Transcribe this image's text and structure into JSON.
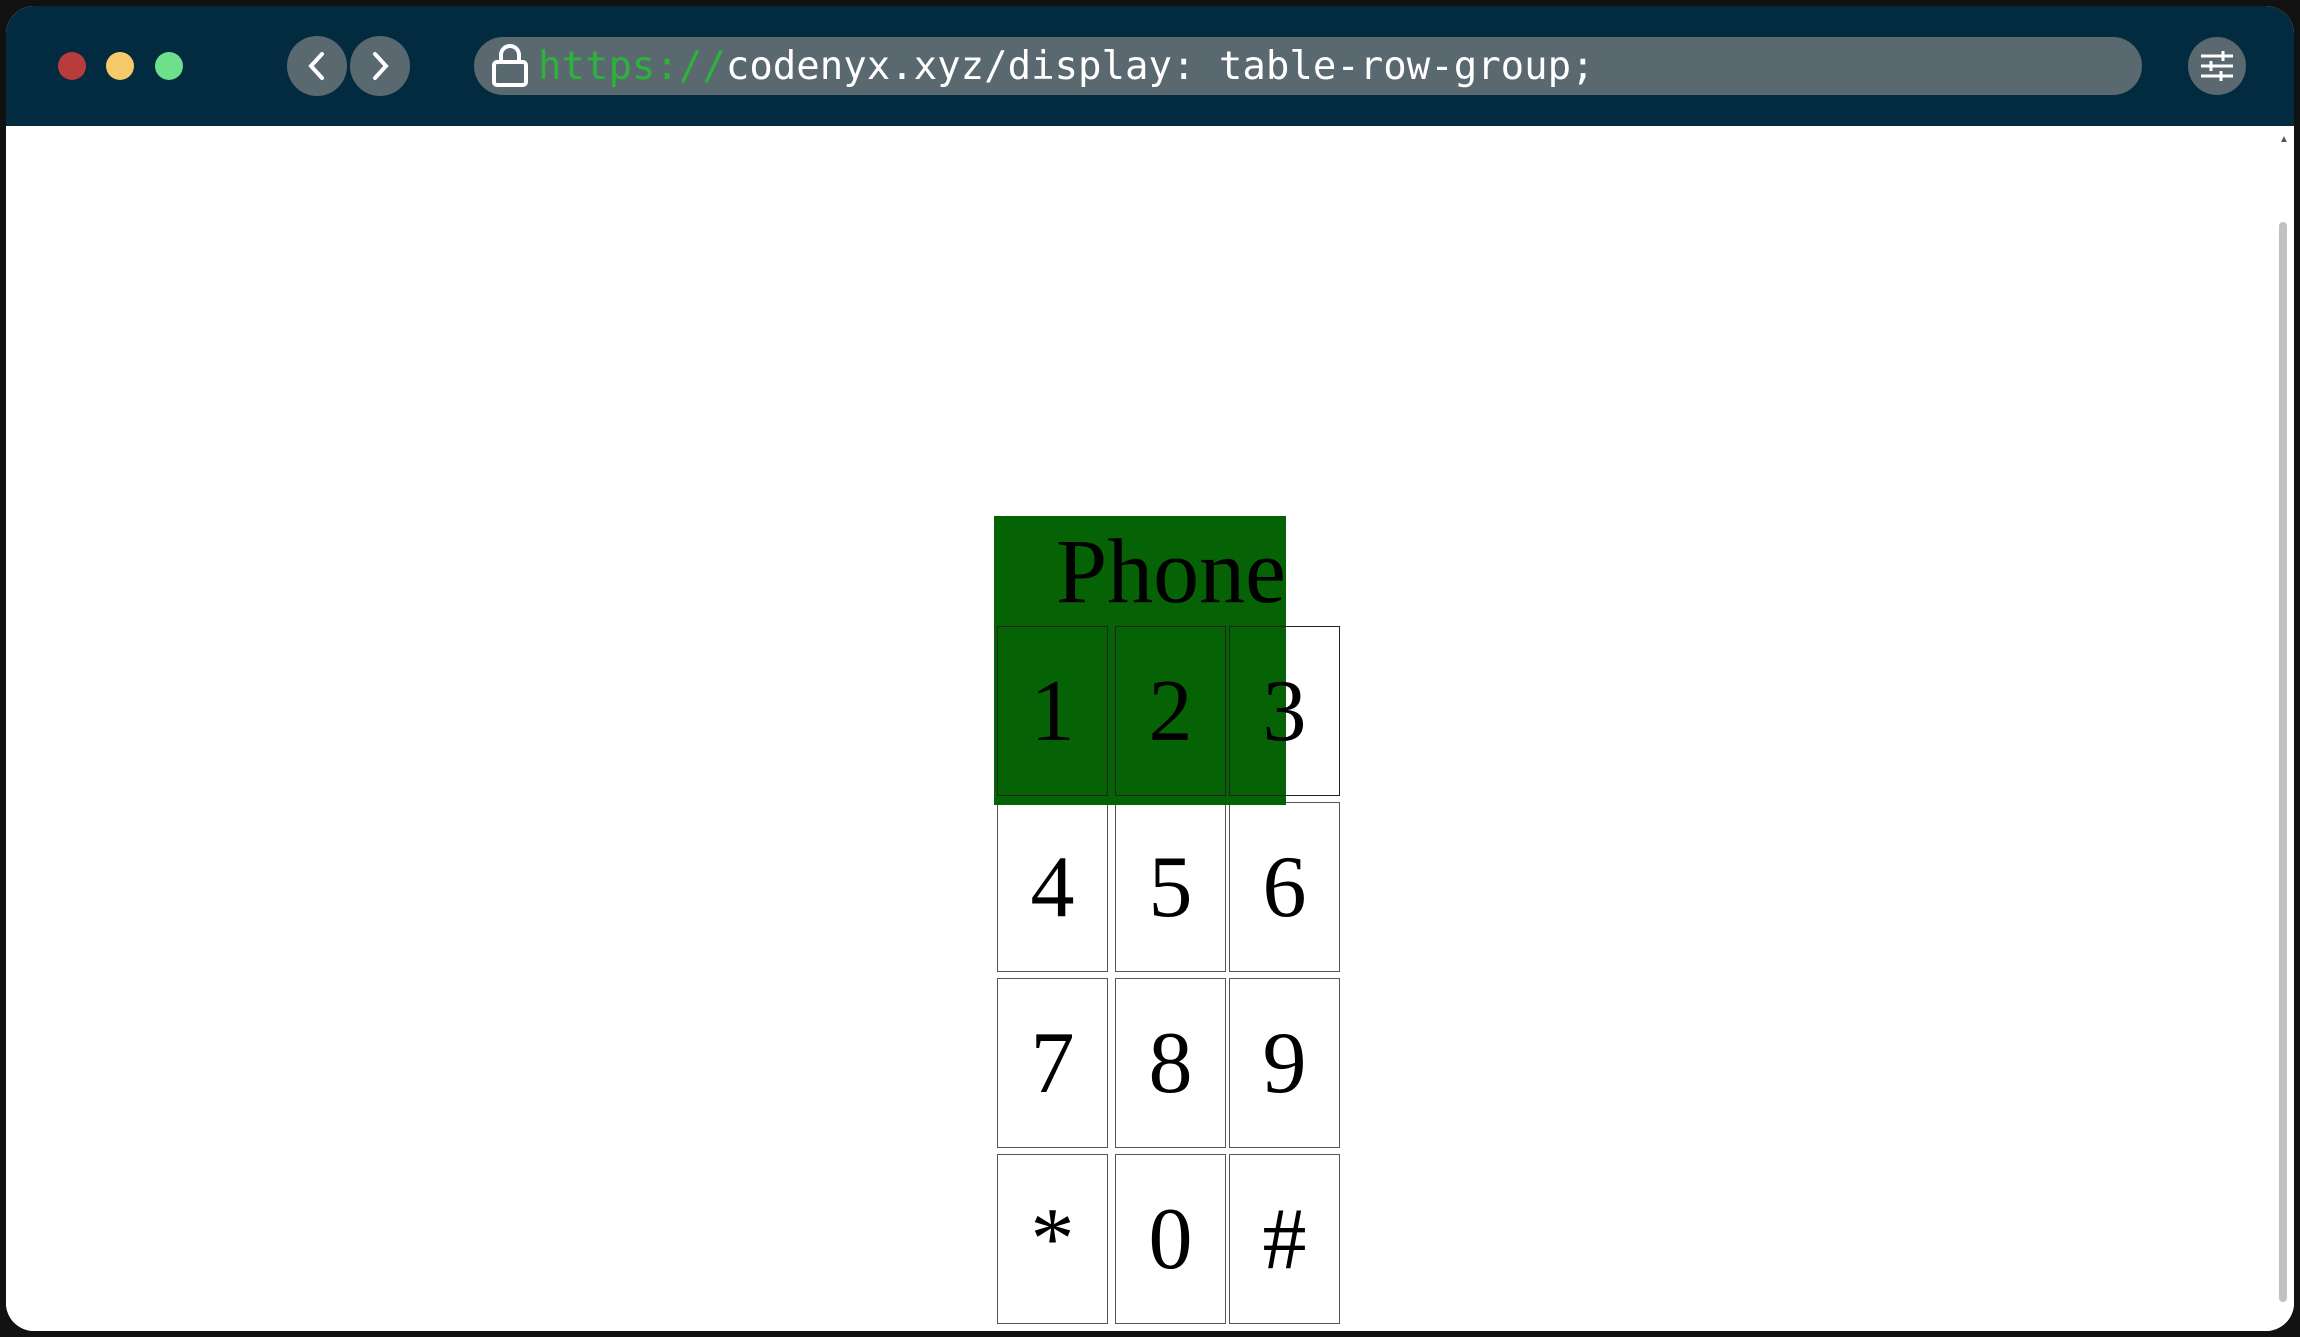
{
  "browser": {
    "url_protocol": "https://",
    "url_rest": "codenyx.xyz/display: table-row-group;",
    "icons": [
      "close-dot",
      "minimize-dot",
      "maximize-dot",
      "chevron-left-icon",
      "chevron-right-icon",
      "lock-icon",
      "sliders-icon"
    ],
    "colors": {
      "close": "#b83c3c",
      "minimize": "#f6c96b",
      "maximize": "#6ee08c",
      "topbar": "#032b40"
    }
  },
  "page": {
    "caption": "Phone",
    "keys": [
      [
        "1",
        "2",
        "3"
      ],
      [
        "4",
        "5",
        "6"
      ],
      [
        "7",
        "8",
        "9"
      ],
      [
        "*",
        "0",
        "#"
      ]
    ],
    "highlight_color": "#006000"
  }
}
